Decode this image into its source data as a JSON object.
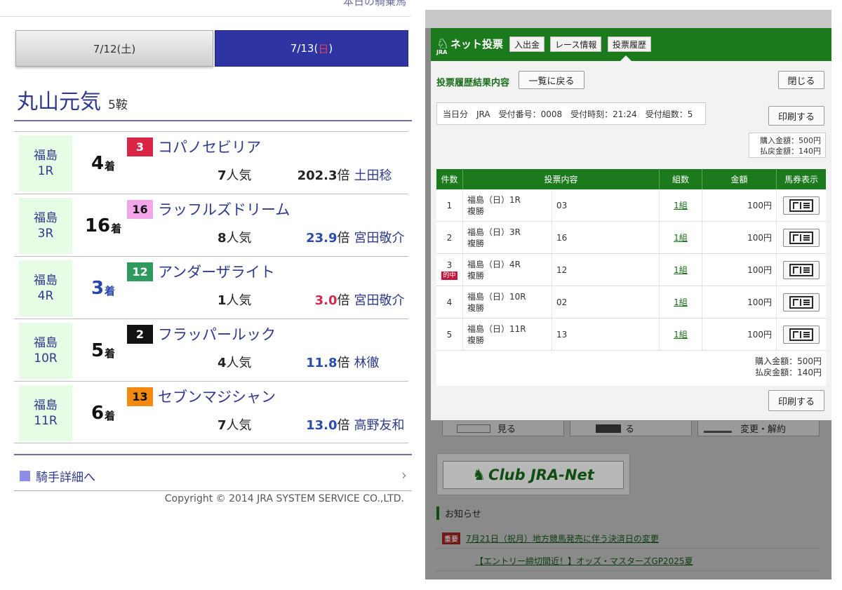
{
  "left": {
    "top_cut_text": "本日の騎乗馬",
    "date_tabs": [
      {
        "label": "7/12(土)",
        "active": false
      },
      {
        "label_prefix": "7/13(",
        "label_day": "日",
        "label_suffix": ")",
        "active": true
      }
    ],
    "jockey": {
      "name": "丸山元気",
      "rides": "5鞍"
    },
    "races": [
      {
        "venue": "福島",
        "race": "1R",
        "place": "4",
        "place_suffix": "着",
        "place_blue": false,
        "horse_num": "3",
        "horse_num_bg": "#d92546",
        "horse_num_fg": "#ffffff",
        "horse": "コパノセビリア",
        "pop": "7",
        "pop_suffix": "人気",
        "odds": "202.3",
        "odds_color": "black",
        "odds_suffix": "倍",
        "rider": "土田稔"
      },
      {
        "venue": "福島",
        "race": "3R",
        "place": "16",
        "place_suffix": "着",
        "place_blue": false,
        "horse_num": "16",
        "horse_num_bg": "#f3a6ea",
        "horse_num_fg": "#111111",
        "horse": "ラッフルズドリーム",
        "pop": "8",
        "pop_suffix": "人気",
        "odds": "23.9",
        "odds_color": "blue",
        "odds_suffix": "倍",
        "rider": "宮田敬介"
      },
      {
        "venue": "福島",
        "race": "4R",
        "place": "3",
        "place_suffix": "着",
        "place_blue": true,
        "horse_num": "12",
        "horse_num_bg": "#2e9a5e",
        "horse_num_fg": "#ffffff",
        "horse": "アンダーザライト",
        "pop": "1",
        "pop_suffix": "人気",
        "odds": "3.0",
        "odds_color": "red",
        "odds_suffix": "倍",
        "rider": "宮田敬介"
      },
      {
        "venue": "福島",
        "race": "10R",
        "place": "5",
        "place_suffix": "着",
        "place_blue": false,
        "horse_num": "2",
        "horse_num_bg": "#111111",
        "horse_num_fg": "#ffffff",
        "horse": "フラッパールック",
        "pop": "4",
        "pop_suffix": "人気",
        "odds": "11.8",
        "odds_color": "blue",
        "odds_suffix": "倍",
        "rider": "林徹"
      },
      {
        "venue": "福島",
        "race": "11R",
        "place": "6",
        "place_suffix": "着",
        "place_blue": false,
        "horse_num": "13",
        "horse_num_bg": "#f28a12",
        "horse_num_fg": "#111111",
        "horse": "セブンマジシャン",
        "pop": "7",
        "pop_suffix": "人気",
        "odds": "13.0",
        "odds_color": "blue",
        "odds_suffix": "倍",
        "rider": "高野友和"
      }
    ],
    "detail_link": "騎手詳細へ",
    "copyright": "Copyright © 2014 JRA SYSTEM SERVICE CO.,LTD."
  },
  "right": {
    "logo": {
      "text": "ネット投票",
      "sub": "JRA"
    },
    "nav": [
      "入出金",
      "レース情報",
      "投票履歴"
    ],
    "modal": {
      "title": "投票履歴結果内容",
      "back_button": "一覧に戻る",
      "close_button": "閉じる",
      "info": "当日分　JRA　受付番号：0008　受付時刻：21:24　受付組数：5",
      "print_button": "印刷する",
      "purchase_label": "購入金額：500円",
      "refund_label": "払戻金額：140円",
      "columns": [
        "件数",
        "投票内容",
        "組数",
        "金額",
        "馬券表示"
      ],
      "rows": [
        {
          "no": "1",
          "hit": false,
          "race": "福島（日）1R",
          "type": "複勝",
          "selection": "03",
          "combos": "1組",
          "amount": "100円"
        },
        {
          "no": "2",
          "hit": false,
          "race": "福島（日）3R",
          "type": "複勝",
          "selection": "16",
          "combos": "1組",
          "amount": "100円"
        },
        {
          "no": "3",
          "hit": true,
          "hit_label": "的中",
          "race": "福島（日）4R",
          "type": "複勝",
          "selection": "12",
          "combos": "1組",
          "amount": "100円"
        },
        {
          "no": "4",
          "hit": false,
          "race": "福島（日）10R",
          "type": "複勝",
          "selection": "02",
          "combos": "1組",
          "amount": "100円"
        },
        {
          "no": "5",
          "hit": false,
          "race": "福島（日）11R",
          "type": "複勝",
          "selection": "13",
          "combos": "1組",
          "amount": "100円"
        }
      ],
      "footer_purchase": "購入金額：500円",
      "footer_refund": "払戻金額：140円",
      "print_button_bottom": "印刷する"
    },
    "behind": {
      "tile_1": "見る",
      "tile_2": "る",
      "tile_3": "変更・解約",
      "club": "Club JRA-Net",
      "notice_title": "お知らせ",
      "notice_tag": "重要",
      "notice_1": "7月21日（祝月）地方競馬発売に伴う決済日の変更",
      "notice_2": "【エントリー締切間近！】オッズ・マスターズGP2025夏"
    }
  },
  "colors": {
    "jra_green": "#1a7a1c",
    "brand_blue": "#2e34a2",
    "text_blue": "#2f3a8c",
    "venue_bg": "#e6fce4"
  }
}
